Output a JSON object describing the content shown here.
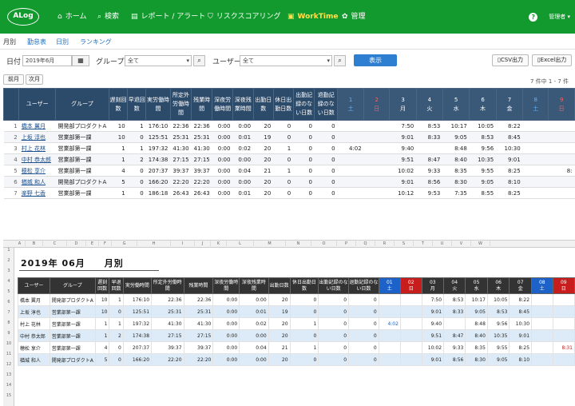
{
  "nav": {
    "logo": "ALog",
    "items": [
      "ホーム",
      "検索",
      "レポート / アラート",
      "リスクスコアリング",
      "WorkTime",
      "管理"
    ],
    "active": "WorkTime",
    "user": "管理者 ▾"
  },
  "tabs": {
    "monthly": "月別",
    "report": "勤怠表",
    "daily": "日別",
    "ranking": "ランキング"
  },
  "filter": {
    "date_label": "日付",
    "date_value": "2019年6月",
    "group_label": "グループ",
    "group_value": "全て",
    "user_label": "ユーザー",
    "user_value": "全て",
    "display_btn": "表示",
    "csv_btn": "CSV出力",
    "excel_btn": "Excel出力",
    "prev_btn": "前月",
    "next_btn": "次月",
    "count": "7 件中 1 - 7 件"
  },
  "web_table": {
    "headers": [
      "ユーザー",
      "グループ",
      "遅刻回数",
      "早退回数",
      "実労働時間",
      "所定外労働時間",
      "残業時間",
      "深夜労働時間",
      "深夜残業時間",
      "出勤日数",
      "休日出勤日数",
      "出勤記録のない日数",
      "退勤記録のない日数"
    ],
    "days": [
      {
        "d": "1",
        "w": "土",
        "t": "sat"
      },
      {
        "d": "2",
        "w": "日",
        "t": "sun"
      },
      {
        "d": "3",
        "w": "月",
        "t": ""
      },
      {
        "d": "4",
        "w": "火",
        "t": ""
      },
      {
        "d": "5",
        "w": "水",
        "t": ""
      },
      {
        "d": "6",
        "w": "木",
        "t": ""
      },
      {
        "d": "7",
        "w": "金",
        "t": ""
      },
      {
        "d": "8",
        "w": "土",
        "t": "sat"
      },
      {
        "d": "9",
        "w": "日",
        "t": "sun"
      }
    ],
    "rows": [
      [
        "1",
        "橋本 翼月",
        "開発部プロダクトA",
        "10",
        "1",
        "176:10",
        "22:36",
        "22:36",
        "0:00",
        "0:00",
        "20",
        "0",
        "0",
        "0",
        "",
        "",
        "7:50",
        "8:53",
        "10:17",
        "10:05",
        "8:22",
        "",
        ""
      ],
      [
        "2",
        "上坂 淳也",
        "営業部第一課",
        "10",
        "0",
        "125:51",
        "25:31",
        "25:31",
        "0:00",
        "0:01",
        "19",
        "0",
        "0",
        "0",
        "",
        "",
        "9:01",
        "8:33",
        "9:05",
        "8:53",
        "8:45",
        "",
        ""
      ],
      [
        "3",
        "村上 花林",
        "営業部第一課",
        "1",
        "1",
        "197:32",
        "41:30",
        "41:30",
        "0:00",
        "0:02",
        "20",
        "1",
        "0",
        "0",
        "4:02",
        "",
        "9:40",
        "",
        "8:48",
        "9:56",
        "10:30",
        "",
        ""
      ],
      [
        "4",
        "中村 恭太郎",
        "営業部第一課",
        "1",
        "2",
        "174:38",
        "27:15",
        "27:15",
        "0:00",
        "0:00",
        "20",
        "0",
        "0",
        "0",
        "",
        "",
        "9:51",
        "8:47",
        "8:40",
        "10:35",
        "9:01",
        "",
        ""
      ],
      [
        "5",
        "穂松 享介",
        "営業部第一課",
        "4",
        "0",
        "207:37",
        "39:37",
        "39:37",
        "0:00",
        "0:04",
        "21",
        "1",
        "0",
        "0",
        "",
        "",
        "10:02",
        "9:33",
        "8:35",
        "9:55",
        "8:25",
        "",
        "8:"
      ],
      [
        "6",
        "楢城 和人",
        "開発部プロダクトA",
        "5",
        "0",
        "166:20",
        "22:20",
        "22:20",
        "0:00",
        "0:00",
        "20",
        "0",
        "0",
        "0",
        "",
        "",
        "9:01",
        "8:56",
        "8:30",
        "9:05",
        "8:10",
        "",
        ""
      ],
      [
        "7",
        "楽野 七香",
        "営業部第一課",
        "1",
        "0",
        "186:18",
        "26:43",
        "26:43",
        "0:00",
        "0:01",
        "20",
        "0",
        "0",
        "0",
        "",
        "",
        "10:12",
        "9:53",
        "7:35",
        "8:55",
        "8:25",
        "",
        ""
      ]
    ]
  },
  "excel": {
    "title": "2019年 06月　　月別",
    "cols": [
      "A",
      "B",
      "C",
      "D",
      "E",
      "F",
      "G",
      "H",
      "I",
      "J",
      "K",
      "L",
      "M",
      "N",
      "O",
      "P",
      "Q",
      "R",
      "S",
      "T",
      "U",
      "V",
      "W"
    ],
    "row_nums": [
      "1",
      "2",
      "3",
      "4",
      "5",
      "6",
      "7",
      "8",
      "9",
      "10",
      "11",
      "12",
      "13",
      "14",
      "15"
    ],
    "headers": [
      "ユーザー",
      "グループ",
      "遅刻回数",
      "早退回数",
      "実労働時間",
      "所定外労働時間",
      "残業時間",
      "深夜労働時間",
      "深夜残業時間",
      "出勤日数",
      "休日出勤日数",
      "出勤記録のない日数",
      "退勤記録のない日数"
    ],
    "days": [
      {
        "d": "01",
        "w": "土",
        "t": "sat"
      },
      {
        "d": "02",
        "w": "日",
        "t": "sun"
      },
      {
        "d": "03",
        "w": "月",
        "t": ""
      },
      {
        "d": "04",
        "w": "火",
        "t": ""
      },
      {
        "d": "05",
        "w": "水",
        "t": ""
      },
      {
        "d": "06",
        "w": "木",
        "t": ""
      },
      {
        "d": "07",
        "w": "金",
        "t": ""
      },
      {
        "d": "08",
        "w": "土",
        "t": "sat"
      },
      {
        "d": "09",
        "w": "日",
        "t": "sun"
      }
    ],
    "rows": [
      [
        "橋本 翼月",
        "開発部プロダクトA",
        "10",
        "1",
        "176:10",
        "22:36",
        "22:36",
        "0:00",
        "0:00",
        "20",
        "0",
        "0",
        "0",
        "",
        "",
        "7:50",
        "8:53",
        "10:17",
        "10:05",
        "8:22",
        "",
        ""
      ],
      [
        "上坂 淳也",
        "営業部第一課",
        "10",
        "0",
        "125:51",
        "25:31",
        "25:31",
        "0:00",
        "0:01",
        "19",
        "0",
        "0",
        "0",
        "",
        "",
        "9:01",
        "8:33",
        "9:05",
        "8:53",
        "8:45",
        "",
        ""
      ],
      [
        "村上 花林",
        "営業部第一課",
        "1",
        "1",
        "197:32",
        "41:30",
        "41:30",
        "0:00",
        "0:02",
        "20",
        "1",
        "0",
        "0",
        "4:02",
        "",
        "9:40",
        "",
        "8:48",
        "9:56",
        "10:30",
        "",
        ""
      ],
      [
        "中村 恭太郎",
        "営業部第一課",
        "1",
        "2",
        "174:38",
        "27:15",
        "27:15",
        "0:00",
        "0:00",
        "20",
        "0",
        "0",
        "0",
        "",
        "",
        "9:51",
        "8:47",
        "8:40",
        "10:35",
        "9:01",
        "",
        ""
      ],
      [
        "穂松 享介",
        "営業部第一課",
        "4",
        "0",
        "207:37",
        "39:37",
        "39:37",
        "0:00",
        "0:04",
        "21",
        "1",
        "0",
        "0",
        "",
        "",
        "10:02",
        "9:33",
        "8:35",
        "9:55",
        "8:25",
        "",
        "8:31"
      ],
      [
        "楢城 和人",
        "開発部プロダクトA",
        "5",
        "0",
        "166:20",
        "22:20",
        "22:20",
        "0:00",
        "0:00",
        "20",
        "0",
        "0",
        "0",
        "",
        "",
        "9:01",
        "8:56",
        "8:30",
        "9:05",
        "8:10",
        "",
        ""
      ]
    ]
  }
}
